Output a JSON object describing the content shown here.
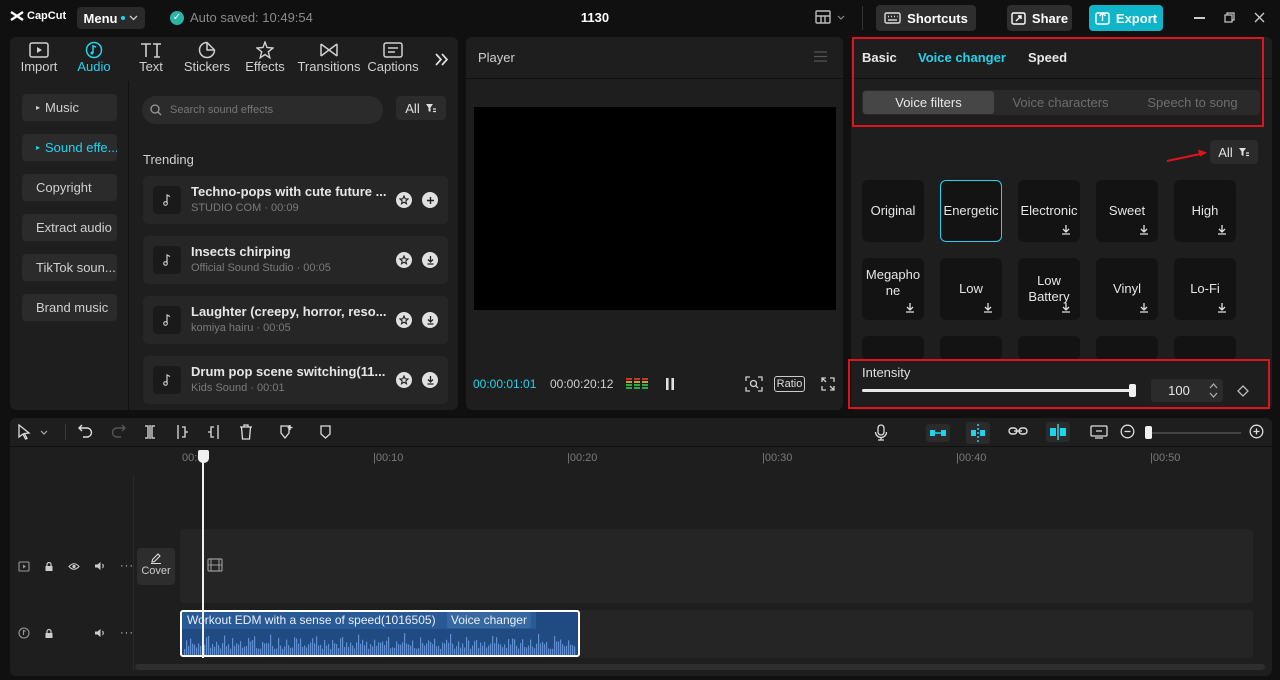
{
  "app": {
    "logo_text": "CapCut",
    "menu_label": "Menu",
    "autosave": "Auto saved: 10:49:54",
    "project_title": "1130"
  },
  "titlebar": {
    "shortcuts": "Shortcuts",
    "share": "Share",
    "export": "Export"
  },
  "categories": [
    {
      "label": "Import",
      "icon": "import-icon"
    },
    {
      "label": "Audio",
      "icon": "audio-icon",
      "active": true
    },
    {
      "label": "Text",
      "icon": "text-icon"
    },
    {
      "label": "Stickers",
      "icon": "stickers-icon"
    },
    {
      "label": "Effects",
      "icon": "effects-icon"
    },
    {
      "label": "Transitions",
      "icon": "transitions-icon"
    },
    {
      "label": "Captions",
      "icon": "captions-icon"
    }
  ],
  "sidebar": {
    "items": [
      "Music",
      "Sound effe...",
      "Copyright",
      "Extract audio",
      "TikTok soun...",
      "Brand music"
    ]
  },
  "search": {
    "placeholder": "Search sound effects",
    "filter_label": "All"
  },
  "trending_label": "Trending",
  "sounds": [
    {
      "title": "Techno-pops with cute future ...",
      "sub": "STUDIO COM · 00:09"
    },
    {
      "title": "Insects chirping",
      "sub": "Official Sound Studio · 00:05"
    },
    {
      "title": "Laughter (creepy, horror, reso...",
      "sub": "komiya hairu · 00:05"
    },
    {
      "title": "Drum pop scene switching(11...",
      "sub": "Kids Sound · 00:01"
    }
  ],
  "player": {
    "title": "Player",
    "current_time": "00:00:01:01",
    "total_time": "00:00:20:12",
    "ratio_label": "Ratio"
  },
  "right_panel": {
    "tabs": [
      "Basic",
      "Voice changer",
      "Speed"
    ],
    "active_tab": "Voice changer",
    "subtabs": [
      "Voice filters",
      "Voice characters",
      "Speech to song"
    ],
    "filter_label": "All",
    "filters": [
      "Original",
      "Energetic",
      "Electronic",
      "Sweet",
      "High",
      "Megapho ne",
      "Low",
      "Low Battery",
      "Vinyl",
      "Lo-Fi"
    ],
    "selected_filter": "Energetic",
    "intensity_label": "Intensity",
    "intensity_value": "100",
    "intensity_fraction": 1.0
  },
  "timeline": {
    "ruler": [
      "00:00",
      "|00:10",
      "|00:20",
      "|00:30",
      "|00:40",
      "|00:50"
    ],
    "cover_label": "Cover",
    "clip_title": "Workout EDM with a sense of speed(1016505)",
    "clip_tag": "Voice changer"
  },
  "colors": {
    "accent": "#22d3ee",
    "highlight": "#e0141e",
    "clip": "#1f4a82",
    "export_bg": "#0fb5c8"
  }
}
